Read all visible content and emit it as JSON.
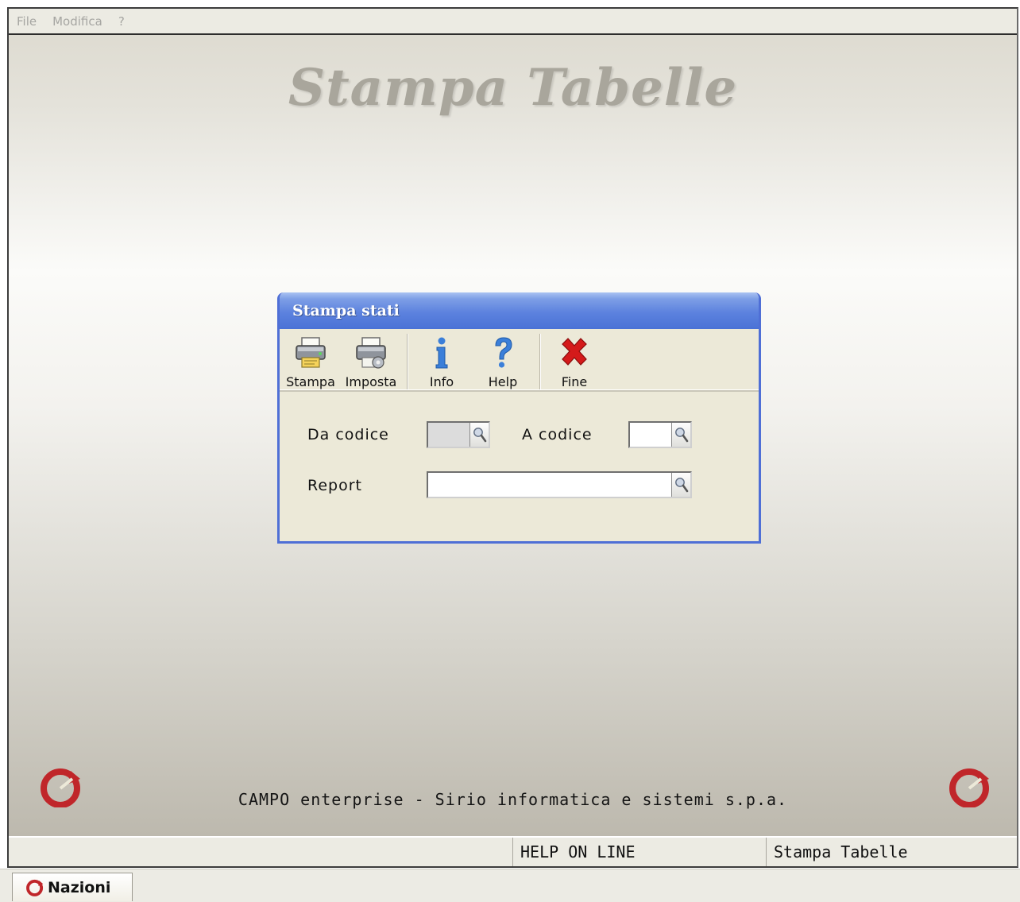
{
  "menubar": {
    "items": [
      "File",
      "Modifica",
      "?"
    ]
  },
  "app": {
    "title": "Stampa Tabelle",
    "footer": "CAMPO enterprise - Sirio informatica e sistemi s.p.a."
  },
  "dialog": {
    "title": "Stampa stati",
    "toolbar": {
      "stampa": "Stampa",
      "imposta": "Imposta",
      "info": "Info",
      "help": "Help",
      "fine": "Fine"
    },
    "form": {
      "da_codice_label": "Da codice",
      "da_codice_value": "",
      "a_codice_label": "A codice",
      "a_codice_value": "",
      "report_label": "Report",
      "report_value": ""
    }
  },
  "statusbar": {
    "help": "HELP ON LINE",
    "module": "Stampa Tabelle"
  },
  "taskbar": {
    "tab_label": "Nazioni"
  },
  "colors": {
    "dialog_accent": "#4a72d6",
    "close_red": "#d41a1a",
    "logo_red": "#c0262a"
  }
}
